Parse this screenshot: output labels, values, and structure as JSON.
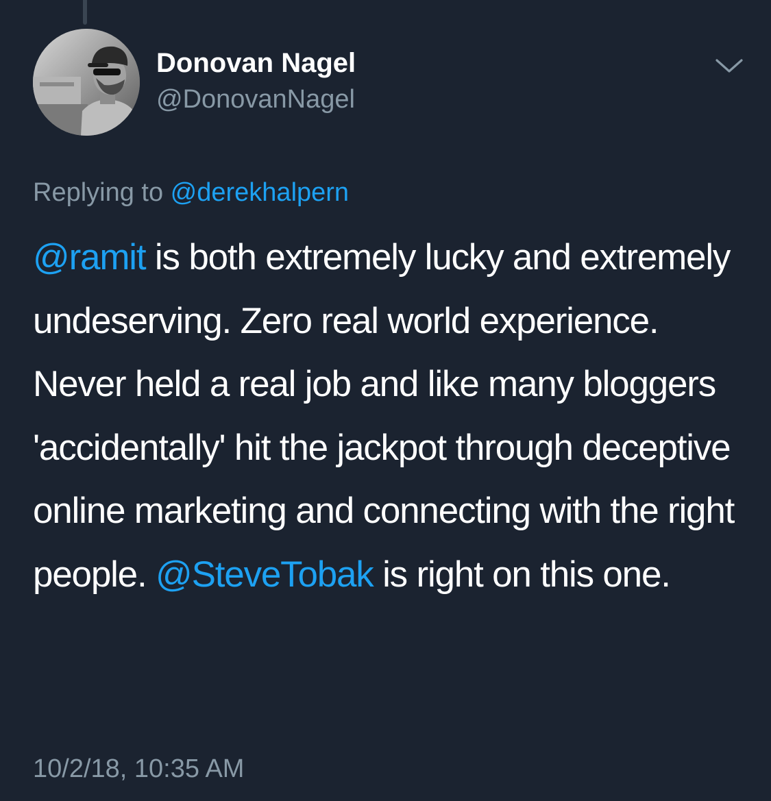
{
  "author": {
    "display_name": "Donovan Nagel",
    "handle": "@DonovanNagel",
    "avatar_icon": "user-avatar-photo"
  },
  "reply": {
    "prefix": "Replying to ",
    "mention": "@derekhalpern"
  },
  "tweet": {
    "mention_1": "@ramit",
    "text_1": " is both extremely lucky and extremely undeserving. Zero real world experience. Never held a real job and like many bloggers 'accidentally' hit the jackpot through deceptive online marketing and connecting with the right people. ",
    "mention_2": "@SteveTobak",
    "text_2": " is right on this one."
  },
  "timestamp": "10/2/18, 10:35 AM",
  "colors": {
    "background": "#1b2330",
    "link": "#1da1f2",
    "secondary_text": "#8899a6",
    "primary_text": "#ffffff"
  },
  "icons": {
    "menu": "chevron-down-icon"
  }
}
